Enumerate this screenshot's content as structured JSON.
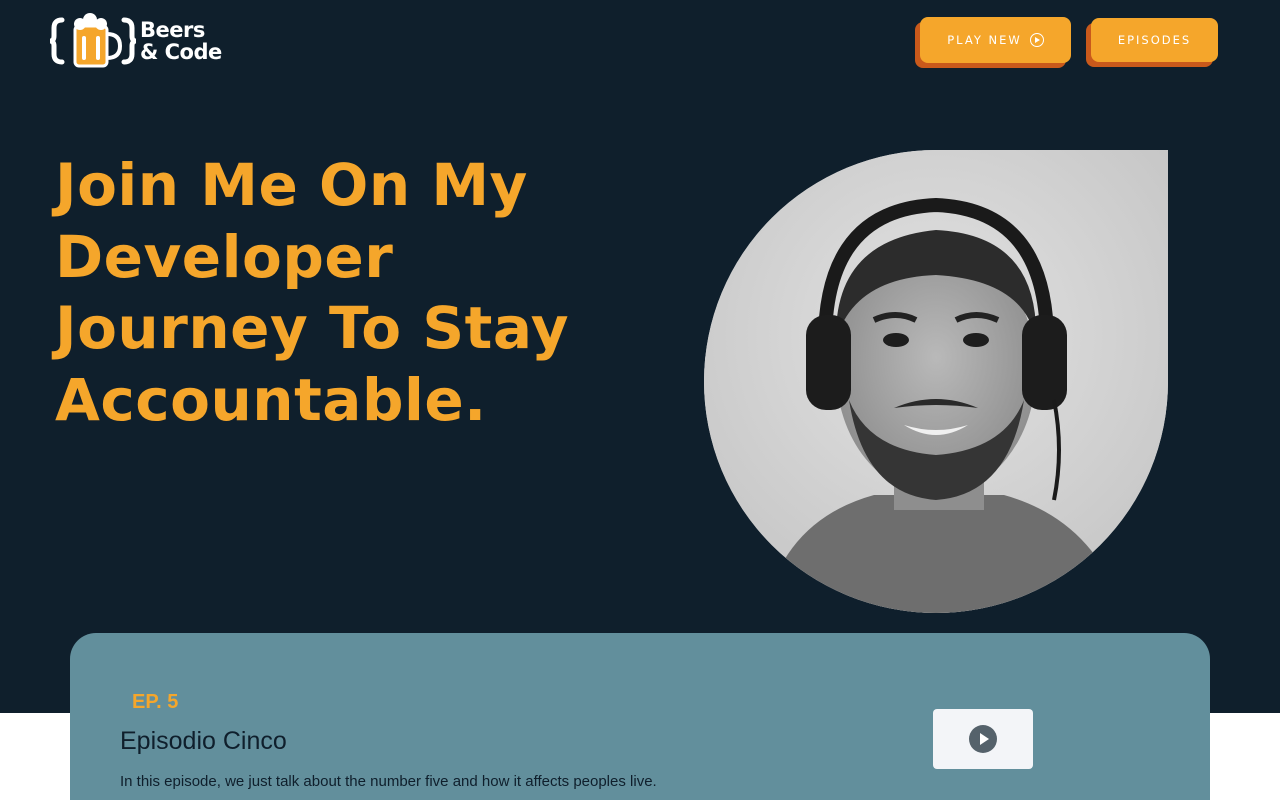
{
  "header": {
    "logo_line1": "Beers",
    "logo_line2": "& Code",
    "logo_icon": "beer-mug-braces-icon",
    "play_new_label": "PLAY NEW",
    "episodes_label": "EPISODES"
  },
  "hero": {
    "headline_lines": [
      "Join Me On My",
      "Developer",
      "Journey To Stay",
      "Accountable."
    ],
    "portrait_icon": "host-portrait"
  },
  "episode": {
    "number": "EP. 5",
    "title": "Episodio Cinco",
    "description": "In this episode, we just talk about the number five and how it affects peoples live.",
    "player_icon": "play-icon"
  },
  "colors": {
    "background": "#0f1f2c",
    "accent": "#f5a62b",
    "accent_shadow": "#c9591b",
    "card": "#628f9c"
  }
}
